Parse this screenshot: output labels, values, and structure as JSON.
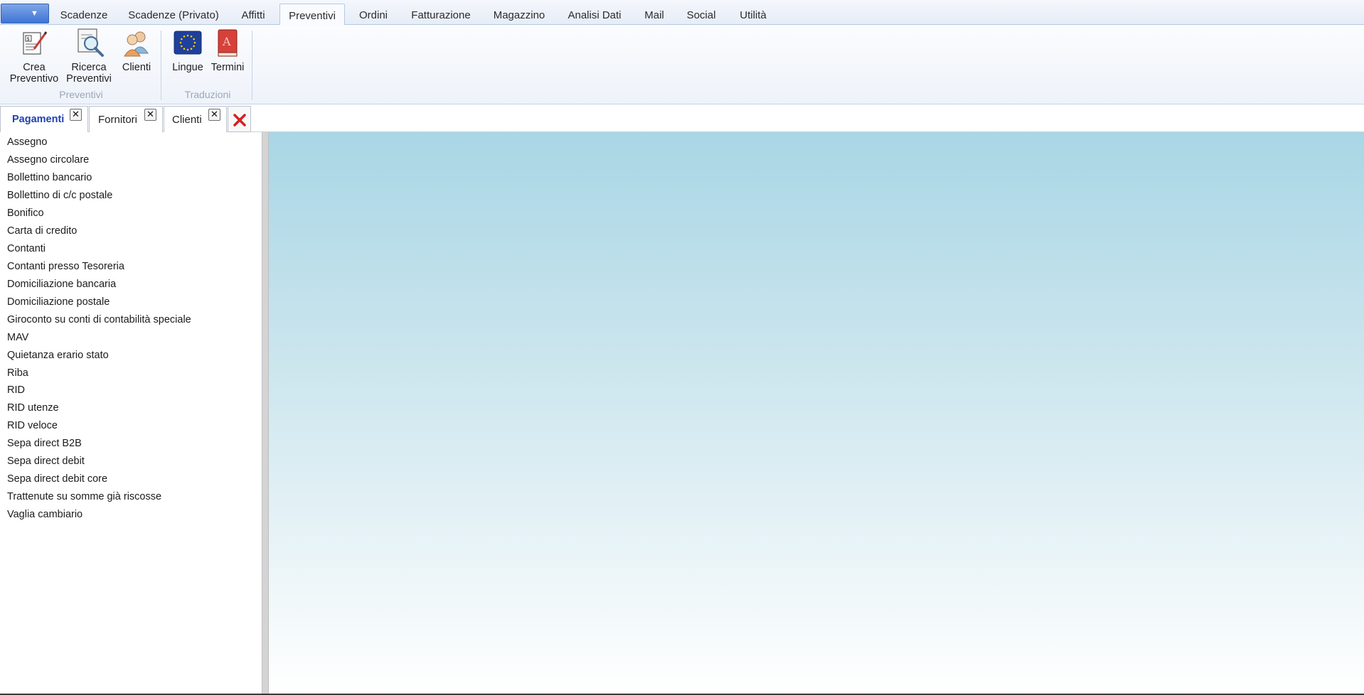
{
  "app_menu": {
    "caret": "▼"
  },
  "ribbon_tabs": [
    {
      "label": "Scadenze"
    },
    {
      "label": "Scadenze (Privato)"
    },
    {
      "label": "Affitti"
    },
    {
      "label": "Preventivi",
      "active": true
    },
    {
      "label": "Ordini"
    },
    {
      "label": "Fatturazione"
    },
    {
      "label": "Magazzino"
    },
    {
      "label": "Analisi Dati"
    },
    {
      "label": "Mail"
    },
    {
      "label": "Social"
    },
    {
      "label": "Utilità"
    }
  ],
  "ribbon": {
    "groups": [
      {
        "label": "Preventivi",
        "buttons": [
          {
            "line1": "Crea",
            "line2": "Preventivo",
            "icon": "create-quote-icon"
          },
          {
            "line1": "Ricerca",
            "line2": "Preventivi",
            "icon": "search-quotes-icon"
          },
          {
            "line1": "Clienti",
            "line2": "",
            "icon": "customers-icon"
          }
        ]
      },
      {
        "label": "Traduzioni",
        "buttons": [
          {
            "line1": "Lingue",
            "line2": "",
            "icon": "eu-flag-icon"
          },
          {
            "line1": "Termini",
            "line2": "",
            "icon": "dictionary-icon"
          }
        ]
      }
    ]
  },
  "doc_tabs": [
    {
      "label": "Pagamenti",
      "active": true
    },
    {
      "label": "Fornitori"
    },
    {
      "label": "Clienti"
    }
  ],
  "close_symbol": "✕",
  "payment_methods": [
    "Assegno",
    "Assegno circolare",
    "Bollettino bancario",
    "Bollettino di c/c postale",
    "Bonifico",
    "Carta di credito",
    "Contanti",
    "Contanti presso Tesoreria",
    "Domiciliazione bancaria",
    "Domiciliazione postale",
    "Giroconto su conti di contabilità speciale",
    "MAV",
    "Quietanza erario stato",
    "Riba",
    "RID",
    "RID utenze",
    "RID veloce",
    "Sepa direct B2B",
    "Sepa direct debit",
    "Sepa direct debit core",
    "Trattenute su somme già riscosse",
    "Vaglia cambiario"
  ],
  "colors": {
    "active_doc_tab": "#1f3fb3",
    "canvas_top": "#a9d6e5",
    "close_all_red": "#d42020"
  }
}
